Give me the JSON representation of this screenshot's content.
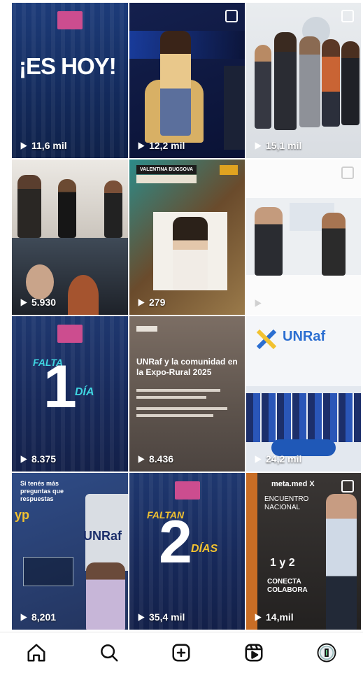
{
  "posts": [
    {
      "views": "11,6 mil",
      "headline": "¡ES HOY!"
    },
    {
      "views": "12,2 mil"
    },
    {
      "views": "15,1 mil"
    },
    {
      "views": "5.930"
    },
    {
      "views": "279",
      "banner": "VALENTINA BUGSOVA"
    },
    {
      "views": ""
    },
    {
      "views": "8.375",
      "headline1": "FALTA",
      "number": "1",
      "headline2": "DÍA"
    },
    {
      "views": "8.436",
      "title": "UNRaf y la comunidad en la Expo-Rural 2025"
    },
    {
      "views": "24,2 mil",
      "logo": "UNRaf"
    },
    {
      "views": "8,201",
      "text1": "Si tenés más preguntas que respuestas",
      "logo": "UNRaf"
    },
    {
      "views": "35,4 mil",
      "headline1": "FALTAN",
      "number": "2",
      "headline2": "DÍAS"
    },
    {
      "views": "14,mil",
      "brand": "meta.med X",
      "event": "ENCUENTRO NACIONAL",
      "dates": "1 y 2",
      "slogan": "CONECTA COLABORA"
    }
  ],
  "nav": [
    "home-icon",
    "search-icon",
    "create-icon",
    "reels-icon",
    "profile-icon"
  ]
}
